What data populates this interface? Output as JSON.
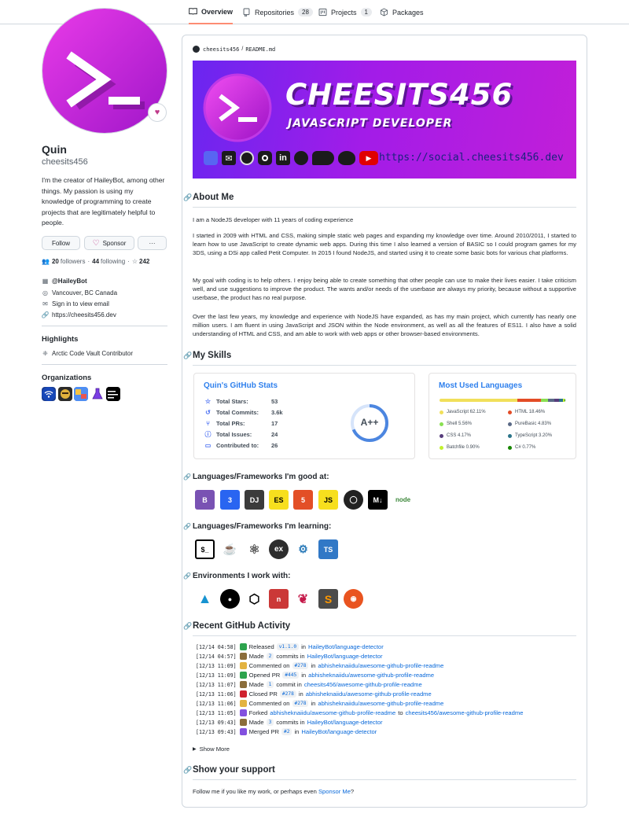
{
  "nav": {
    "tabs": [
      {
        "label": "Overview",
        "icon": "book-icon",
        "count": ""
      },
      {
        "label": "Repositories",
        "icon": "repo-icon",
        "count": "28"
      },
      {
        "label": "Projects",
        "icon": "project-icon",
        "count": "1"
      },
      {
        "label": "Packages",
        "icon": "package-icon",
        "count": ""
      }
    ]
  },
  "profile": {
    "name": "Quin",
    "login": "cheesits456",
    "bio": "I'm the creator of HaileyBot, among other things. My passion is using my knowledge of programming to create projects that are legitimately helpful to people.",
    "follow_label": "Follow",
    "sponsor_label": "Sponsor",
    "more_label": "···",
    "followers": "20",
    "followers_label": "followers",
    "following": "44",
    "following_label": "following",
    "stars": "242",
    "company": "@HaileyBot",
    "location": "Vancouver, BC Canada",
    "email": "Sign in to view email",
    "website": "https://cheesits456.dev",
    "highlights_heading": "Highlights",
    "highlight_item": "Arctic Code Vault Contributor",
    "organizations_heading": "Organizations"
  },
  "readme": {
    "path_user": "cheesits456",
    "path_sep": "/",
    "path_file": "README.md",
    "banner": {
      "title": "CHEESITS456",
      "subtitle": "JAVASCRIPT DEVELOPER",
      "url": "https://social.cheesits456.dev"
    },
    "about_heading": "About Me",
    "about_p1": "I am a NodeJS developer with 11 years of coding experience",
    "about_p2": "I started in 2009 with HTML and CSS, making simple static web pages and expanding my knowledge over time. Around 2010/2011, I started to learn how to use JavaScript to create dynamic web apps. During this time I also learned a version of BASIC so I could program games for my 3DS, using a DSi app called Petit Computer. In 2015 I found NodeJS, and started using it to create some basic bots for various chat platforms.",
    "about_p3": "My goal with coding is to help others. I enjoy being able to create something that other people can use to make their lives easier. I take criticism well, and use suggestions to improve the product. The wants and/or needs of the userbase are always my priority, because without a supportive userbase, the product has no real purpose.",
    "about_p4": "Over the last few years, my knowledge and experience with NodeJS have expanded, as has my main project, which currently has nearly one million users. I am fluent in using JavaScript and JSON within the Node environment, as well as all the features of ES11. I also have a solid understanding of HTML and CSS, and am able to work with web apps or other browser-based environments.",
    "skills_heading": "My Skills",
    "stats": {
      "title": "Quin's GitHub Stats",
      "rows": [
        {
          "label": "Total Stars:",
          "value": "53"
        },
        {
          "label": "Total Commits:",
          "value": "3.6k"
        },
        {
          "label": "Total PRs:",
          "value": "17"
        },
        {
          "label": "Total Issues:",
          "value": "24"
        },
        {
          "label": "Contributed to:",
          "value": "26"
        }
      ],
      "grade": "A++"
    },
    "languages": {
      "title": "Most Used Languages",
      "items": [
        {
          "label": "JavaScript 62.11%",
          "color": "#f1e05a",
          "pct": 62.11
        },
        {
          "label": "HTML 18.46%",
          "color": "#e34c26",
          "pct": 18.46
        },
        {
          "label": "Shell 5.56%",
          "color": "#89e051",
          "pct": 5.56
        },
        {
          "label": "PureBasic 4.83%",
          "color": "#5a6986",
          "pct": 4.83
        },
        {
          "label": "CSS 4.17%",
          "color": "#563d7c",
          "pct": 4.17
        },
        {
          "label": "TypeScript 3.20%",
          "color": "#2b7489",
          "pct": 3.2
        },
        {
          "label": "Batchfile 0.90%",
          "color": "#c1f12e",
          "pct": 0.9
        },
        {
          "label": "C# 0.77%",
          "color": "#178600",
          "pct": 0.77
        }
      ]
    },
    "good_heading": "Languages/Frameworks I'm good at:",
    "learning_heading": "Languages/Frameworks I'm learning:",
    "env_heading": "Environments I work with:",
    "activity_heading": "Recent GitHub Activity",
    "activity": [
      {
        "ts": "[12/14 04:58]",
        "icon": "tag-icon",
        "color": "#2da44e",
        "text": "Released",
        "code": "v1.1.0",
        "mid": "in",
        "link1": "HaileyBot/language-detector",
        "tail": "",
        "link2": ""
      },
      {
        "ts": "[12/14 04:57]",
        "icon": "commit-icon",
        "color": "#8a6d3b",
        "text": "Made",
        "code": "2",
        "mid": "commits in",
        "link1": "HaileyBot/language-detector",
        "tail": "",
        "link2": ""
      },
      {
        "ts": "[12/13 11:09]",
        "icon": "comment-icon",
        "color": "#e3b341",
        "text": "Commented on",
        "code": "#278",
        "mid": "in",
        "link1": "abhisheknaiidu/awesome-github-profile-readme",
        "tail": "",
        "link2": ""
      },
      {
        "ts": "[12/13 11:09]",
        "icon": "pr-open-icon",
        "color": "#2da44e",
        "text": "Opened PR",
        "code": "#445",
        "mid": "in",
        "link1": "abhisheknaiidu/awesome-github-profile-readme",
        "tail": "",
        "link2": ""
      },
      {
        "ts": "[12/13 11:07]",
        "icon": "commit-icon",
        "color": "#8a6d3b",
        "text": "Made",
        "code": "1",
        "mid": "commit in",
        "link1": "cheesits456/awesome-github-profile-readme",
        "tail": "",
        "link2": ""
      },
      {
        "ts": "[12/13 11:06]",
        "icon": "pr-closed-icon",
        "color": "#cf222e",
        "text": "Closed PR",
        "code": "#278",
        "mid": "in",
        "link1": "abhisheknaiidu/awesome-github-profile-readme",
        "tail": "",
        "link2": ""
      },
      {
        "ts": "[12/13 11:06]",
        "icon": "comment-icon",
        "color": "#e3b341",
        "text": "Commented on",
        "code": "#278",
        "mid": "in",
        "link1": "abhisheknaiidu/awesome-github-profile-readme",
        "tail": "",
        "link2": ""
      },
      {
        "ts": "[12/13 11:05]",
        "icon": "fork-icon",
        "color": "#8250df",
        "text": "Forked",
        "code": "",
        "mid": "",
        "link1": "abhisheknaiidu/awesome-github-profile-readme",
        "tail": "to",
        "link2": "cheesits456/awesome-github-profile-readme"
      },
      {
        "ts": "[12/13 09:43]",
        "icon": "commit-icon",
        "color": "#8a6d3b",
        "text": "Made",
        "code": "3",
        "mid": "commits in",
        "link1": "HaileyBot/language-detector",
        "tail": "",
        "link2": ""
      },
      {
        "ts": "[12/13 09:43]",
        "icon": "pr-merged-icon",
        "color": "#8250df",
        "text": "Merged PR",
        "code": "#2",
        "mid": "in",
        "link1": "HaileyBot/language-detector",
        "tail": "",
        "link2": ""
      }
    ],
    "show_more": "Show More",
    "support_heading": "Show your support",
    "support_text": "Follow me if you like my work, or perhaps even",
    "support_link": "Sponsor Me",
    "support_end": "?"
  }
}
